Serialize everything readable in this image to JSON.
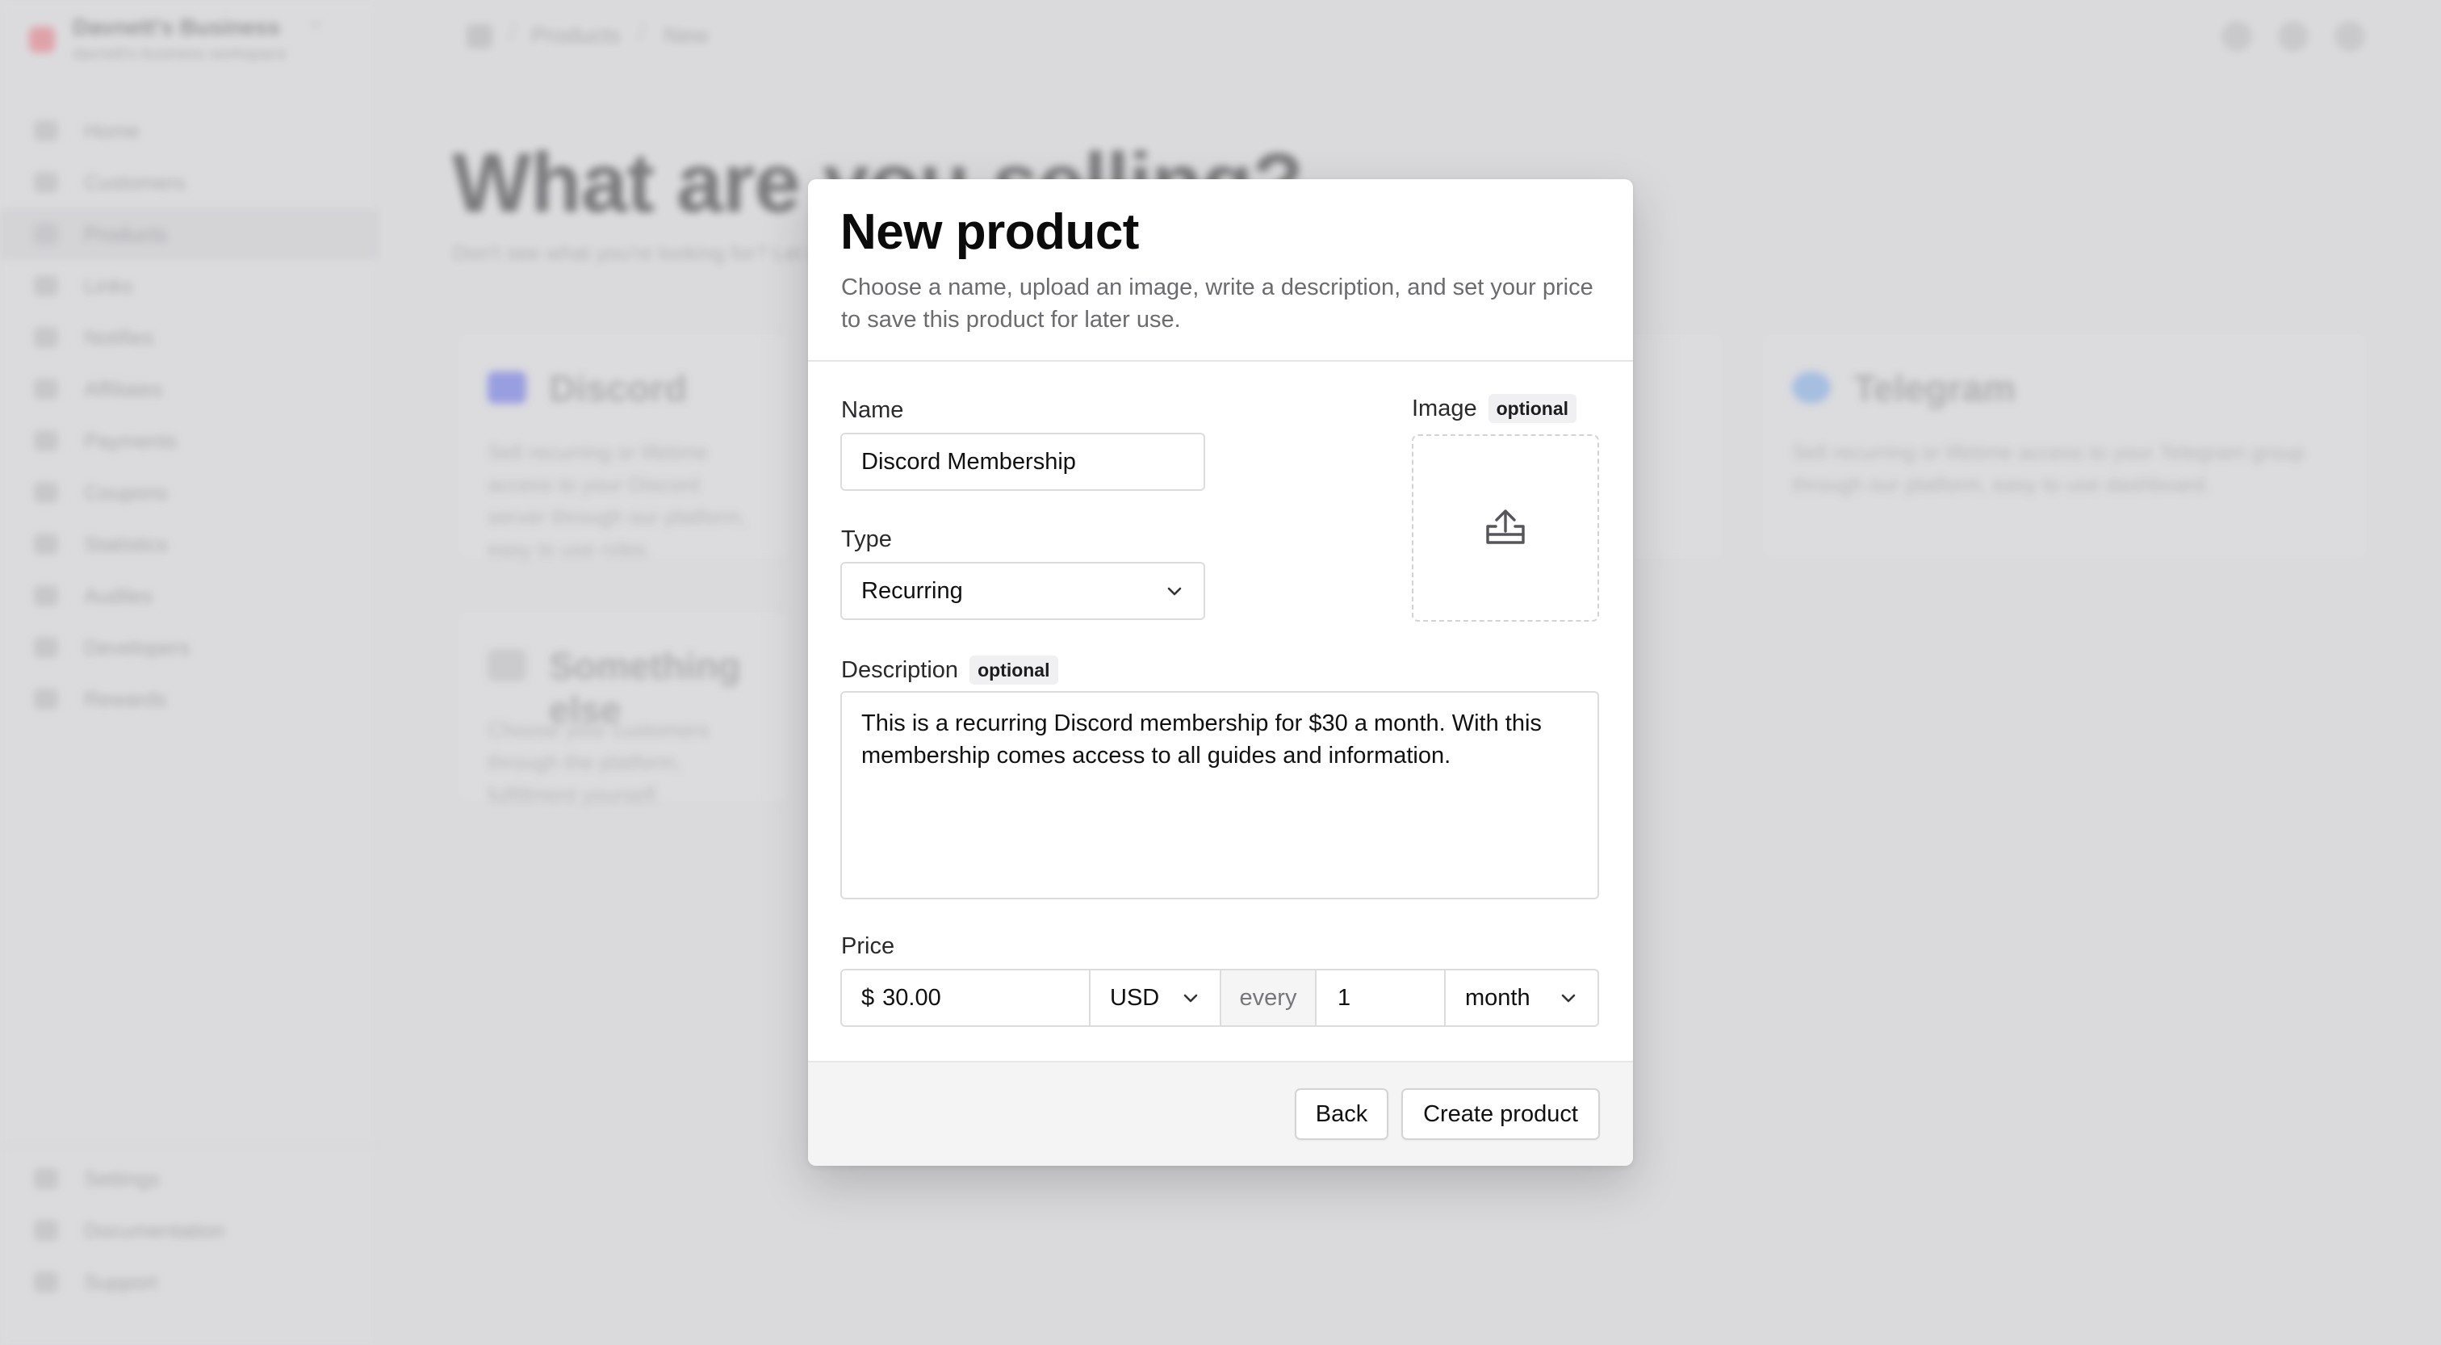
{
  "background": {
    "org": {
      "name": "Davnett's Business",
      "sub": "davnett's business workspace"
    },
    "sidebar_items": [
      "Home",
      "Customers",
      "Products",
      "Links",
      "Notifies",
      "Affiliates",
      "Payments",
      "Coupons",
      "Statistics",
      "Audiles",
      "Developers",
      "Rewards"
    ],
    "sidebar_bottom": [
      "Settings",
      "Documentation",
      "Support"
    ],
    "breadcrumb": [
      "Products",
      "New"
    ],
    "page_title": "What are you selling?",
    "page_subtitle": "Don't see what you're looking for? Let us know.",
    "cards": [
      {
        "title": "Discord",
        "text": "Sell recurring or lifetime access to your Discord server through our platform, easy to use roles.",
        "accent": "#7b83e8"
      },
      {
        "title": "Telegram",
        "text": "Sell recurring or lifetime access to your Telegram group through our platform, easy to use dashboard.",
        "accent": "#8fb6e8"
      },
      {
        "title": "Something else",
        "text": "Choose your customers through the platform, fulfillment yourself.",
        "accent": "#c9c9cc"
      }
    ]
  },
  "modal": {
    "title": "New product",
    "description": "Choose a name, upload an image, write a description, and set your price to save this product for later use.",
    "name_label": "Name",
    "name_value": "Discord Membership",
    "image_label": "Image",
    "optional_badge": "optional",
    "type_label": "Type",
    "type_value": "Recurring",
    "description_label": "Description",
    "description_value": "This is a recurring Discord membership for $30 a month. With this membership comes access to all guides and information.",
    "price_label": "Price",
    "price_symbol": "$",
    "price_value": "30.00",
    "currency": "USD",
    "every_label": "every",
    "interval_count": "1",
    "interval_unit": "month",
    "back_label": "Back",
    "create_label": "Create product"
  },
  "icons": {
    "upload": "upload-tray-icon",
    "chevron": "chevron-down-icon"
  },
  "colors": {
    "backdrop": "#e1e1e3",
    "modal_bg": "#ffffff",
    "footer_bg": "#f4f4f5",
    "border": "#dcdcdf",
    "muted_text": "#6b6b70"
  }
}
